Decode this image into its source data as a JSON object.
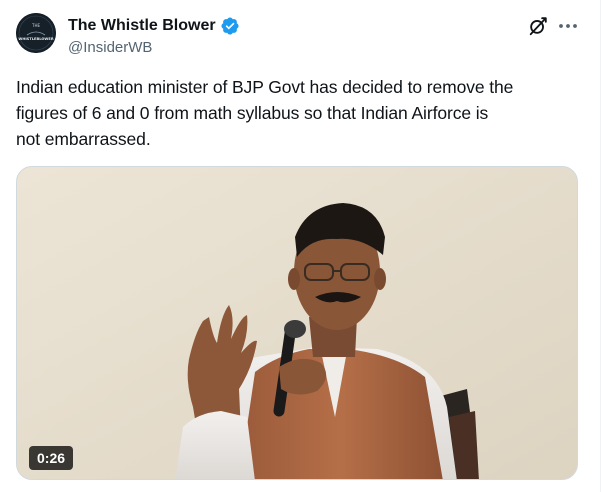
{
  "author": {
    "display_name": "The Whistle Blower",
    "handle": "@InsiderWB",
    "verified": true,
    "avatar_logo_text": "THE WHISTLEBLOWER"
  },
  "header_actions": {
    "grok_icon": "grok-icon",
    "more_icon": "more-icon"
  },
  "tweet": {
    "text": "Indian education minister of BJP Govt has decided to remove the\nfigures of 6 and 0 from math syllabus so that Indian Airforce is\nnot embarrassed."
  },
  "media": {
    "type": "video",
    "duration": "0:26"
  },
  "colors": {
    "verified": "#1d9bf0",
    "text_primary": "#0f1419",
    "text_secondary": "#536471"
  }
}
